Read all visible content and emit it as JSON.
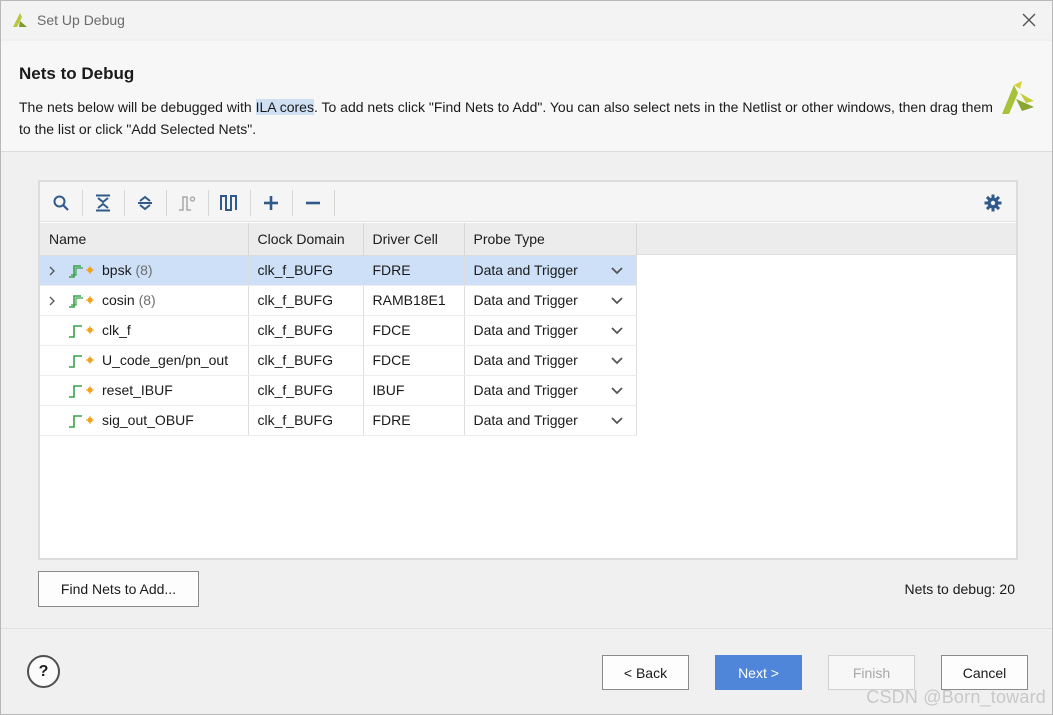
{
  "window": {
    "title": "Set Up Debug"
  },
  "header": {
    "heading": "Nets to Debug",
    "desc_part1": "The nets below will be debugged with ",
    "desc_highlight": "ILA cores",
    "desc_part2": ". To add nets click \"Find Nets to Add\". You can also select nets in the Netlist or other windows, then drag them to the list or click \"Add Selected Nets\"."
  },
  "toolbar": {
    "icons": [
      "search-icon",
      "collapse-all-icon",
      "expand-all-icon",
      "schematic-icon",
      "waveform-icon",
      "add-icon",
      "remove-icon",
      "settings-icon"
    ]
  },
  "table": {
    "columns": [
      "Name",
      "Clock Domain",
      "Driver Cell",
      "Probe Type"
    ],
    "rows": [
      {
        "name": "bpsk",
        "count": "(8)",
        "expandable": true,
        "selected": true,
        "clock": "clk_f_BUFG",
        "driver": "FDRE",
        "probe": "Data and Trigger"
      },
      {
        "name": "cosin",
        "count": "(8)",
        "expandable": true,
        "selected": false,
        "clock": "clk_f_BUFG",
        "driver": "RAMB18E1",
        "probe": "Data and Trigger"
      },
      {
        "name": "clk_f",
        "count": "",
        "expandable": false,
        "selected": false,
        "clock": "clk_f_BUFG",
        "driver": "FDCE",
        "probe": "Data and Trigger"
      },
      {
        "name": "U_code_gen/pn_out",
        "count": "",
        "expandable": false,
        "selected": false,
        "clock": "clk_f_BUFG",
        "driver": "FDCE",
        "probe": "Data and Trigger"
      },
      {
        "name": "reset_IBUF",
        "count": "",
        "expandable": false,
        "selected": false,
        "clock": "clk_f_BUFG",
        "driver": "IBUF",
        "probe": "Data and Trigger"
      },
      {
        "name": "sig_out_OBUF",
        "count": "",
        "expandable": false,
        "selected": false,
        "clock": "clk_f_BUFG",
        "driver": "FDRE",
        "probe": "Data and Trigger"
      }
    ]
  },
  "actions": {
    "find_nets": "Find Nets to Add...",
    "nets_to_debug": "Nets to debug: 20"
  },
  "footer": {
    "help": "?",
    "back": "< Back",
    "next": "Next >",
    "finish": "Finish",
    "cancel": "Cancel"
  },
  "watermark": "CSDN @Born_toward",
  "colors": {
    "accent": "#4f86d9",
    "selection": "#cde0f7",
    "xilinx_logo": "#a7c23a"
  }
}
